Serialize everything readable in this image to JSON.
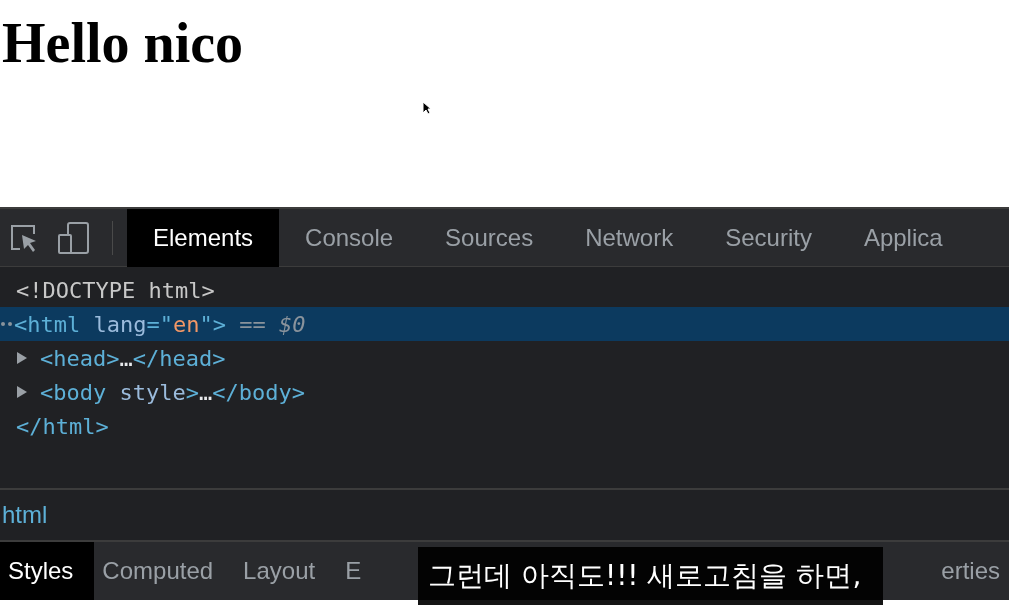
{
  "page": {
    "heading": "Hello nico"
  },
  "devtools": {
    "tabs": [
      {
        "label": "Elements",
        "selected": true
      },
      {
        "label": "Console",
        "selected": false
      },
      {
        "label": "Sources",
        "selected": false
      },
      {
        "label": "Network",
        "selected": false
      },
      {
        "label": "Security",
        "selected": false
      },
      {
        "label": "Applica",
        "selected": false
      }
    ],
    "dom_tree": [
      {
        "kind": "plain",
        "selected": false,
        "segments": [
          {
            "color": "#c8c8c8",
            "text": "<!DOCTYPE html>"
          }
        ]
      },
      {
        "kind": "plain",
        "selected": true,
        "segments": [
          {
            "color": "#5db0d7",
            "text": "<html "
          },
          {
            "color": "#9bbbdc",
            "text": "lang"
          },
          {
            "color": "#5db0d7",
            "text": "=\""
          },
          {
            "color": "#f29766",
            "text": "en"
          },
          {
            "color": "#5db0d7",
            "text": "\">"
          },
          {
            "color": "#8a939c",
            "text": " == $0"
          }
        ]
      },
      {
        "kind": "collapsed",
        "selected": false,
        "segments": [
          {
            "color": "#5db0d7",
            "text": "<head>"
          },
          {
            "color": "#e8eaed",
            "text": "…"
          },
          {
            "color": "#5db0d7",
            "text": "</head>"
          }
        ]
      },
      {
        "kind": "collapsed",
        "selected": false,
        "segments": [
          {
            "color": "#5db0d7",
            "text": "<body "
          },
          {
            "color": "#9bbbdc",
            "text": "style"
          },
          {
            "color": "#5db0d7",
            "text": ">"
          },
          {
            "color": "#e8eaed",
            "text": "…"
          },
          {
            "color": "#5db0d7",
            "text": "</body>"
          }
        ]
      },
      {
        "kind": "plain",
        "selected": false,
        "segments": [
          {
            "color": "#5db0d7",
            "text": "</html>"
          }
        ]
      }
    ],
    "breadcrumb": "html",
    "pane_tabs": [
      {
        "label": "Styles",
        "selected": true
      },
      {
        "label": "Computed",
        "selected": false
      },
      {
        "label": "Layout",
        "selected": false
      },
      {
        "label": "E",
        "selected": false
      },
      {
        "label": "erties",
        "selected": false
      }
    ]
  },
  "subtitle": "그런데 아직도!!! 새로고침을 하면,"
}
